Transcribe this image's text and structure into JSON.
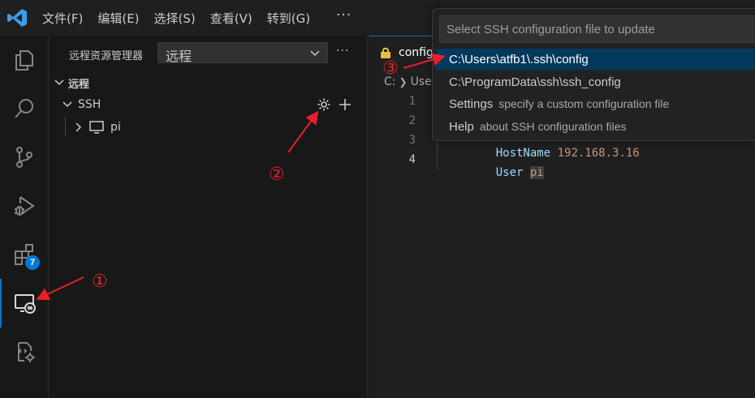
{
  "menu": {
    "items": [
      "文件(F)",
      "编辑(E)",
      "选择(S)",
      "查看(V)",
      "转到(G)"
    ],
    "more": "···"
  },
  "activity_bar": {
    "icons": [
      "explorer-icon",
      "search-icon",
      "source-control-icon",
      "run-debug-icon",
      "extensions-icon",
      "remote-explorer-icon",
      "remote-settings-icon"
    ],
    "extensions_badge": "7",
    "active": "remote-explorer-icon"
  },
  "sidebar": {
    "title": "远程资源管理器",
    "select_value": "远程",
    "more": "···",
    "section_label": "远程",
    "ssh_label": "SSH",
    "host_label": "pi"
  },
  "editor": {
    "tab_label": "config",
    "breadcrumb": [
      "C:",
      "User"
    ],
    "line_numbers": [
      "1",
      "2",
      "3",
      "4"
    ],
    "line3_key": "HostName",
    "line3_value": "192.168.3.16",
    "line4_key": "User",
    "line4_value": "pi"
  },
  "quick_pick": {
    "placeholder": "Select SSH configuration file to update",
    "items": [
      {
        "label": "C:\\Users\\atfb1\\.ssh\\config",
        "description": ""
      },
      {
        "label": "C:\\ProgramData\\ssh\\ssh_config",
        "description": ""
      },
      {
        "label": "Settings",
        "description": "specify a custom configuration file"
      },
      {
        "label": "Help",
        "description": "about SSH configuration files"
      }
    ],
    "selected_index": 0
  },
  "annotations": [
    "①",
    "②",
    "③"
  ],
  "colors": {
    "accent": "#0078d4",
    "annotation": "#e8202a",
    "selection": "#04395e"
  }
}
